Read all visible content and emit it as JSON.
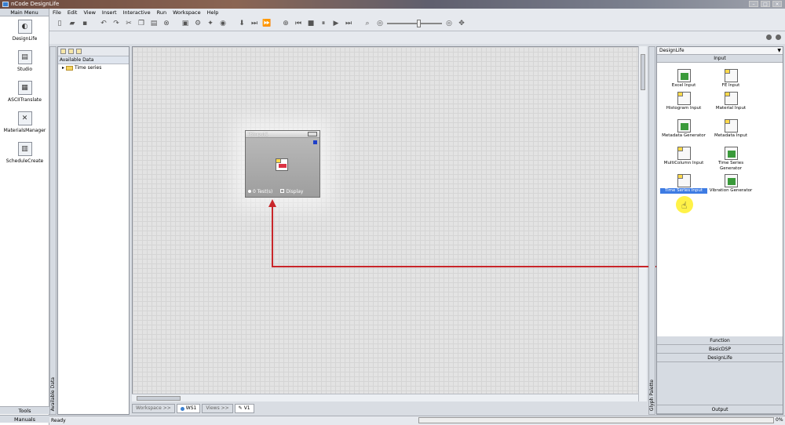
{
  "window": {
    "title": "nCode DesignLife"
  },
  "menu": [
    "File",
    "Edit",
    "View",
    "Insert",
    "Interactive",
    "Run",
    "Workspace",
    "Help"
  ],
  "main_menu": {
    "header": "Main Menu",
    "items": [
      {
        "label": "DesignLife",
        "icon": "designlife-icon"
      },
      {
        "label": "Studio",
        "icon": "studio-icon"
      },
      {
        "label": "ASCIITranslate",
        "icon": "ascii-translate-icon"
      },
      {
        "label": "MaterialsManager",
        "icon": "materials-manager-icon"
      },
      {
        "label": "ScheduleCreate",
        "icon": "schedule-create-icon"
      }
    ],
    "bottom": [
      "Tools",
      "Manuals"
    ]
  },
  "data_panel": {
    "header": "Available Data",
    "vertical_tab": "Available Data",
    "tree": [
      {
        "label": "Time series"
      }
    ]
  },
  "glyph": {
    "title": "TSInput1",
    "footer_left": "0 Test(s)",
    "footer_right": "Display"
  },
  "bottom_tabs": [
    {
      "label": "Workspace >>",
      "active": false
    },
    {
      "label": "WS1",
      "active": true
    },
    {
      "label": "Views >>",
      "active": false
    },
    {
      "label": "V1",
      "active": true
    }
  ],
  "palette": {
    "selector": "DesignLife",
    "vertical_tab": "Glyph Palette",
    "active_category": "Input",
    "items": [
      {
        "label": "Excel Input",
        "icon": "excel-input-icon"
      },
      {
        "label": "FE Input",
        "icon": "fe-input-icon"
      },
      {
        "label": "Histogram Input",
        "icon": "histogram-input-icon"
      },
      {
        "label": "Material Input",
        "icon": "material-input-icon"
      },
      {
        "label": "Metadata Generator",
        "icon": "metadata-generator-icon"
      },
      {
        "label": "Metadata Input",
        "icon": "metadata-input-icon"
      },
      {
        "label": "MultiColumn Input",
        "icon": "multicolumn-input-icon"
      },
      {
        "label": "Time Series Generator",
        "icon": "time-series-generator-icon"
      },
      {
        "label": "Time Series Input",
        "icon": "time-series-input-icon",
        "selected": true
      },
      {
        "label": "Vibration Generator",
        "icon": "vibration-generator-icon"
      }
    ],
    "categories": [
      "Function",
      "BasicDSP",
      "DesignLife",
      "Output"
    ]
  },
  "status": {
    "text": "Ready",
    "percent": "0%"
  },
  "colors": {
    "arrow": "#c8262a",
    "selection": "#3d7be3",
    "highlight": "#fff028"
  }
}
